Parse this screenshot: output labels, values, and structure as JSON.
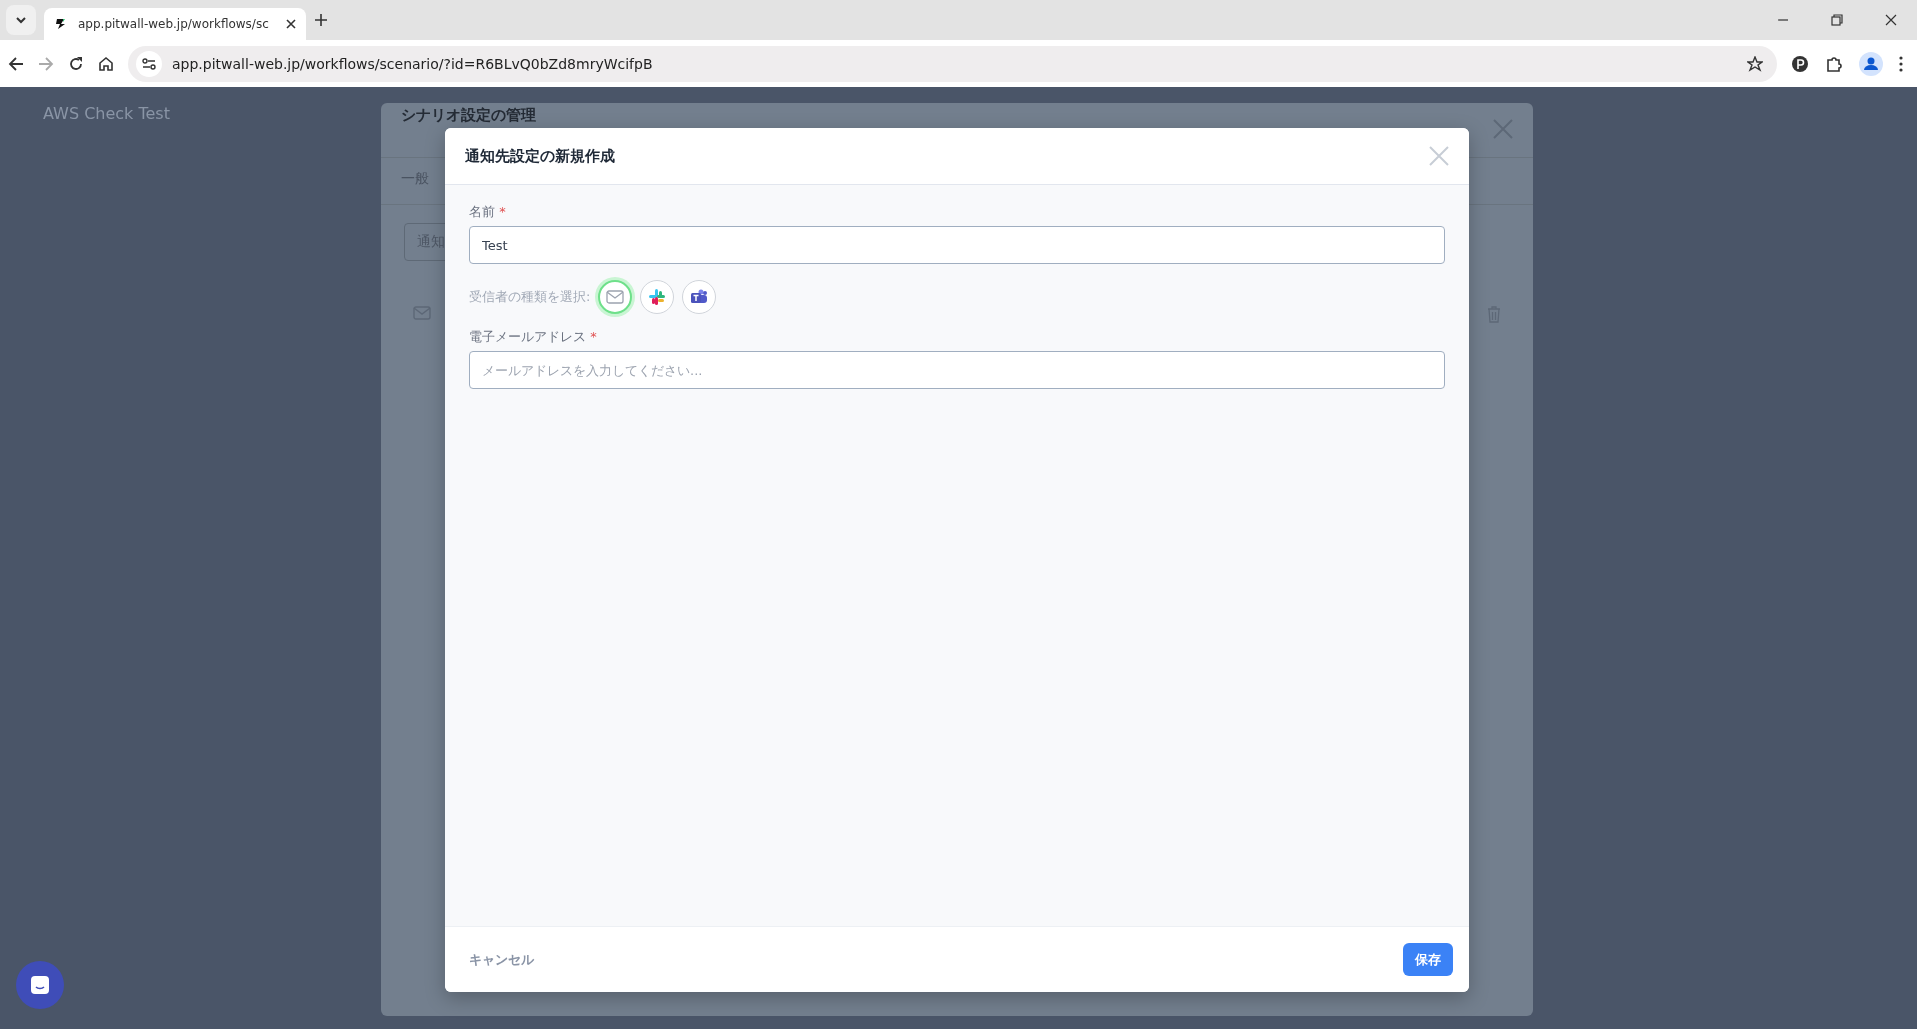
{
  "browser": {
    "tab_title": "app.pitwall-web.jp/workflows/sc",
    "url": "app.pitwall-web.jp/workflows/scenario/?id=R6BLvQ0bZd8mryWcifpB"
  },
  "page": {
    "title": "AWS Check Test"
  },
  "background_dialog": {
    "title": "シナリオ設定の管理",
    "tabs": [
      {
        "label": "一般",
        "selected": false
      }
    ],
    "search_text": "通知"
  },
  "dialog": {
    "title": "通知先設定の新規作成",
    "fields": [
      {
        "label": "名前",
        "required_mark": "*",
        "value": "Test"
      }
    ],
    "recipient_type_label": "受信者の種類を選択:",
    "recipient_types": [
      {
        "kind": "email",
        "selected": true
      },
      {
        "kind": "slack",
        "selected": false
      },
      {
        "kind": "teams",
        "selected": false
      }
    ],
    "email_field": {
      "label": "電子メールアドレス",
      "required_mark": "*",
      "placeholder": "メールアドレスを入力してください..."
    },
    "cancel": "キャンセル",
    "save": "保存"
  }
}
